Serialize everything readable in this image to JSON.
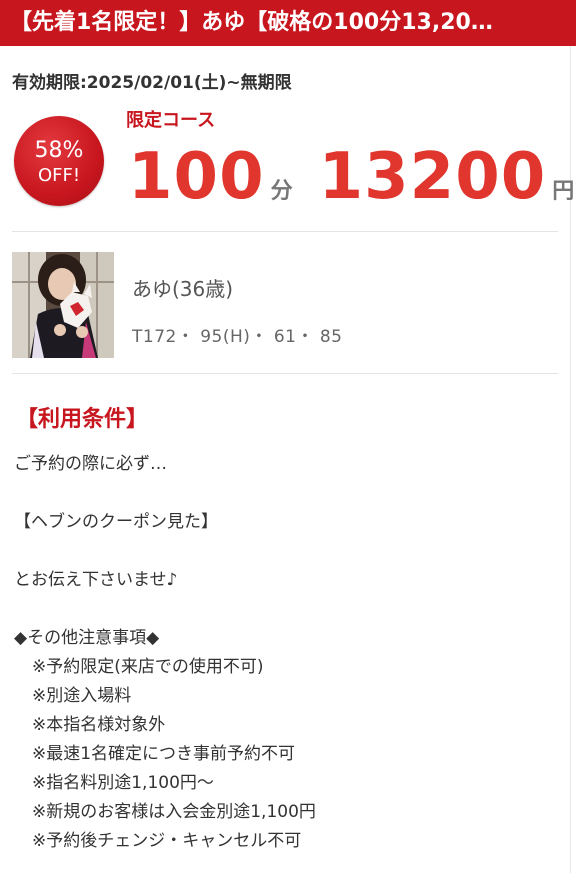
{
  "header": {
    "title": "【先着1名限定！】あゆ【破格の100分13,20…"
  },
  "coupon": {
    "validity": "有効期限:2025/02/01(土)~無期限",
    "discount_percent": "58%",
    "discount_off": "OFF!",
    "course_label": "限定コース",
    "minutes": "100",
    "minutes_unit": "分",
    "price": "13200",
    "price_unit": "円"
  },
  "girl": {
    "name": "あゆ(36歳)",
    "size": "T172・ 95(H)・ 61・ 85"
  },
  "conditions": {
    "title": "【利用条件】",
    "lines": [
      "ご予約の際に必ず…",
      "",
      "【ヘブンのクーポン見た】",
      "",
      "とお伝え下さいませ♪",
      "",
      "◆その他注意事項◆",
      "※予約限定(来店での使用不可)",
      "※別途入場料",
      "※本指名様対象外",
      "※最速1名確定につき事前予約不可",
      "※指名料別途1,100円～",
      "※新規のお客様は入会金別途1,100円",
      "※予約後チェンジ・キャンセル不可"
    ]
  },
  "colors": {
    "brand_red": "#c8161e",
    "price_red": "#e0362e"
  }
}
